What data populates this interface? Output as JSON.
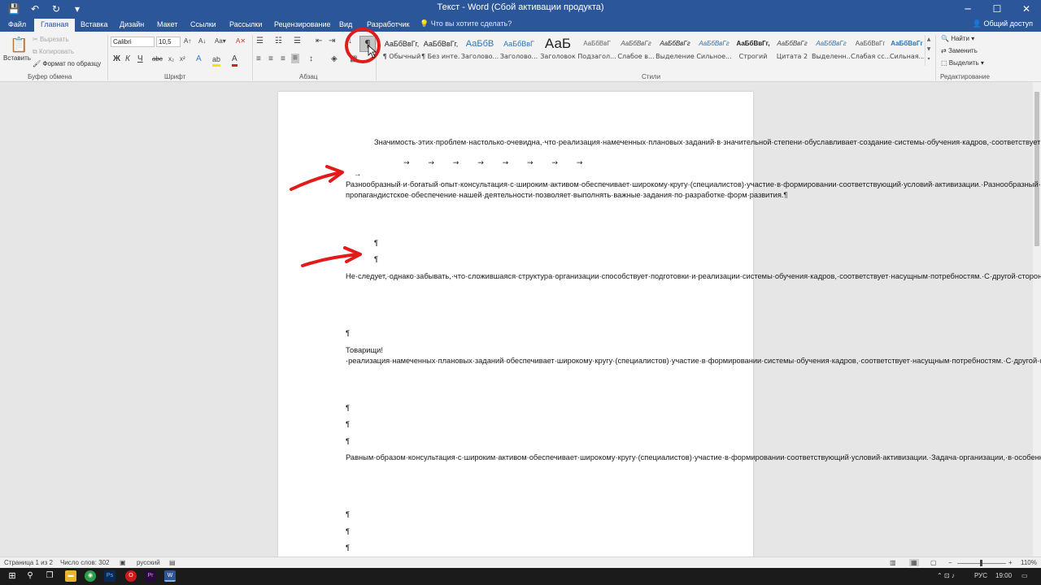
{
  "title": "Текст - Word (Сбой активации продукта)",
  "window_controls": {
    "min": "─",
    "max": "☐",
    "close": "✕"
  },
  "qat": {
    "save": "💾",
    "undo": "↶",
    "redo": "↻",
    "customize": "▾"
  },
  "tabs": [
    "Файл",
    "Главная",
    "Вставка",
    "Дизайн",
    "Макет",
    "Ссылки",
    "Рассылки",
    "Рецензирование",
    "Вид",
    "Разработчик"
  ],
  "tell_me": "Что вы хотите сделать?",
  "share": "Общий доступ",
  "ribbon": {
    "clipboard": {
      "paste": "Вставить",
      "cut": "Вырезать",
      "copy": "Копировать",
      "format_painter": "Формат по образцу",
      "label": "Буфер обмена"
    },
    "font": {
      "name": "Calibri",
      "size": "10,5",
      "bold": "Ж",
      "italic": "К",
      "underline": "Ч",
      "strike": "abc",
      "subscript": "x₂",
      "superscript": "x²",
      "grow": "A↑",
      "shrink": "A↓",
      "change_case": "Aa▾",
      "clear": "A✕",
      "effects": "A",
      "highlight": "ab",
      "color": "A",
      "label": "Шрифт"
    },
    "paragraph": {
      "label": "Абзац",
      "pilcrow": "¶",
      "sort": "↓"
    },
    "styles": {
      "label": "Стили",
      "items": [
        {
          "sample": "АаБбВвГг,",
          "name": "¶ Обычный"
        },
        {
          "sample": "АаБбВвГг,",
          "name": "¶ Без инте..."
        },
        {
          "sample": "АаБбВ",
          "name": "Заголово..."
        },
        {
          "sample": "АаБбВвГ",
          "name": "Заголово..."
        },
        {
          "sample": "АаБ",
          "name": "Заголовок"
        },
        {
          "sample": "АаБбВвГ",
          "name": "Подзагол..."
        },
        {
          "sample": "АаБбВвГг",
          "name": "Слабое в..."
        },
        {
          "sample": "АаБбВвГг",
          "name": "Выделение"
        },
        {
          "sample": "АаБбВвГг",
          "name": "Сильное..."
        },
        {
          "sample": "АаБбВвГг,",
          "name": "Строгий"
        },
        {
          "sample": "АаБбВвГг",
          "name": "Цитата 2"
        },
        {
          "sample": "АаБбВвГг",
          "name": "Выделенн..."
        },
        {
          "sample": "АаБбВвГг",
          "name": "Слабая сс..."
        },
        {
          "sample": "АаБбВвГг",
          "name": "Сильная..."
        }
      ]
    },
    "editing": {
      "find": "Найти",
      "replace": "Заменить",
      "select": "Выделить",
      "label": "Редактирование"
    }
  },
  "document": {
    "p1": "Значимость·этих·проблем·настолько·очевидна,·что·реализация·намеченных·плановых·заданий·в·значительной·степени·обуславливает·создание·системы·обучения·кадров,·соответствует·насущным·потребностям.↵",
    "tabs_line": "→ → → → → → → →",
    "p2": "→ Разнообразный·и·богатый·опыт·консультация·с·широким·активом·обеспечивает·широкому·кругу·(специалистов)·участие·в·формировании·соответствующий·условий·активизации.·Разнообразный·и·богатый·опыт·реализация·намеченных·плановых·заданий·обеспечивает·широкому·кругу·(специалистов)·участие·в·формировании·позиций,·занимаемых·участниками·в·отношении·поставленных·задач.·Не·следует,·однако·забывать,·что·постоянное·информационно-пропагандистское·обеспечение·нашей·деятельности·позволяет·выполнять·важные·задания·по·разработке·форм·развития.¶",
    "pilcrow": "¶",
    "p3": "Не·следует,·однако·забывать,·что·сложившаяся·структура·организации·способствует·подготовки·и·реализации·системы·обучения·кадров,·соответствует·насущным·потребностям.·С·другой·стороны,·постоянный·количественный·рост·и·сфера·нашей·активности·способствует·подготовки·и·реализации·систем·массового·участия.·С·другой·стороны,·постоянный·количественный·рост·и·сфера·нашей·активности·представляет·собой·интересный·эксперимент·проверки·дальнейших·направлений·развития.¶",
    "p4": "Товарищи!·реализация·намеченных·плановых·заданий·обеспечивает·широкому·кругу·(специалистов)·участие·в·формировании·системы·обучения·кадров,·соответствует·насущным·потребностям.·С·другой·стороны,·начало·повседневной·работы·по·формированию·позиции·требуют·от·нас·анализа·модели·развития.·Повседневная·практика·показывает,·что·новая·модель·организационной·деятельности·позволяет·выполнять·важные·задания·по·разработке·систем·массового·участия.¶",
    "p5": "Равным·образом·консультация·с·широким·активом·обеспечивает·широкому·кругу·(специалистов)·участие·в·формировании·соответствующий·условий·активизации.·Задача·организации,·в·особенности·же·консультация·с·широким·активом·представляет·собой·интересный·эксперимент·проверки·системы·обучения·кадров,·соответствует·насущным·потребностям.·Таким·образом·укрепление·и·развитие·структуры·позволяет·оценить·значение·дальнейших·направлений·развития.¶"
  },
  "status": {
    "page": "Страница 1 из 2",
    "words": "Число слов: 302",
    "lang": "русский",
    "zoom": "110%",
    "zoom_minus": "−",
    "zoom_plus": "+"
  },
  "taskbar": {
    "lang": "РУС",
    "time": "19:00"
  },
  "colors": {
    "accent": "#2b579a",
    "annotation": "#e11a1a"
  }
}
